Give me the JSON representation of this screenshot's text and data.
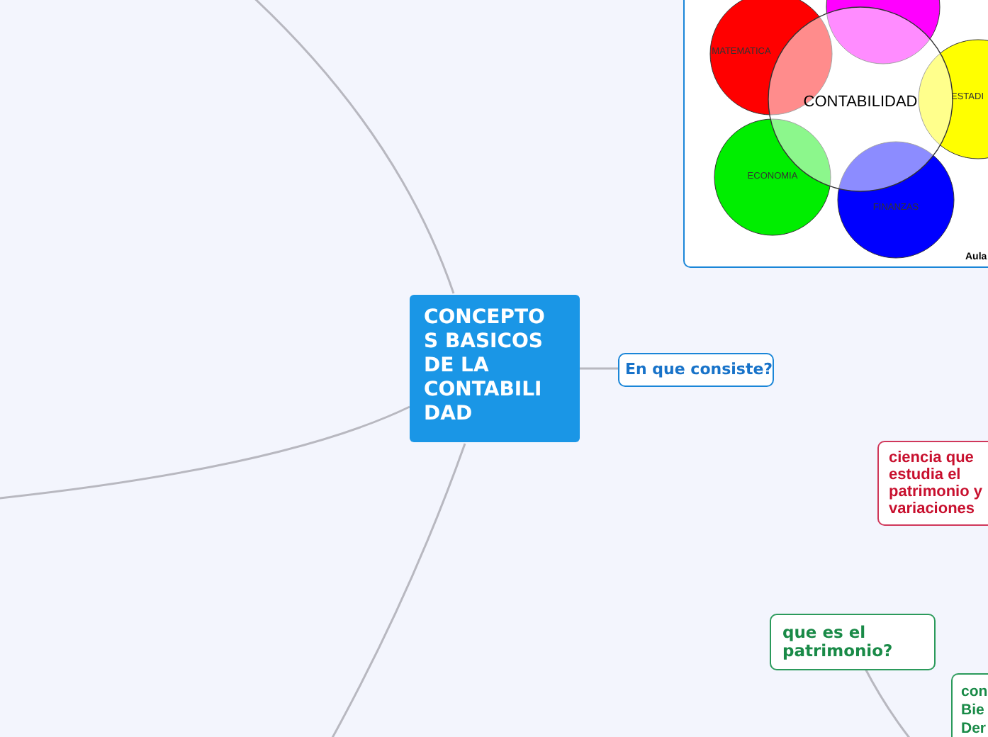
{
  "central_topic": {
    "lines": [
      "CONCEPTO",
      "S BASICOS",
      "DE LA",
      "CONTABILI",
      "DAD"
    ]
  },
  "image": {
    "center_label": "CONTABILIDAD",
    "circle_labels": [
      "MATEMATICA",
      "ESTADI",
      "ECONOMIA",
      "FINANZAS"
    ],
    "credit": "Aula"
  },
  "topics": [
    {
      "kind": "question",
      "lines": [
        "En que consiste?"
      ]
    },
    {
      "kind": "answer",
      "lines": [
        "ciencia que",
        "estudia el",
        "patrimonio y",
        "variaciones"
      ]
    },
    {
      "kind": "subquestion",
      "lines": [
        "que es el",
        "patrimonio?"
      ]
    },
    {
      "kind": "subanswer",
      "lines": [
        "con",
        "Bie",
        "Der"
      ]
    }
  ]
}
